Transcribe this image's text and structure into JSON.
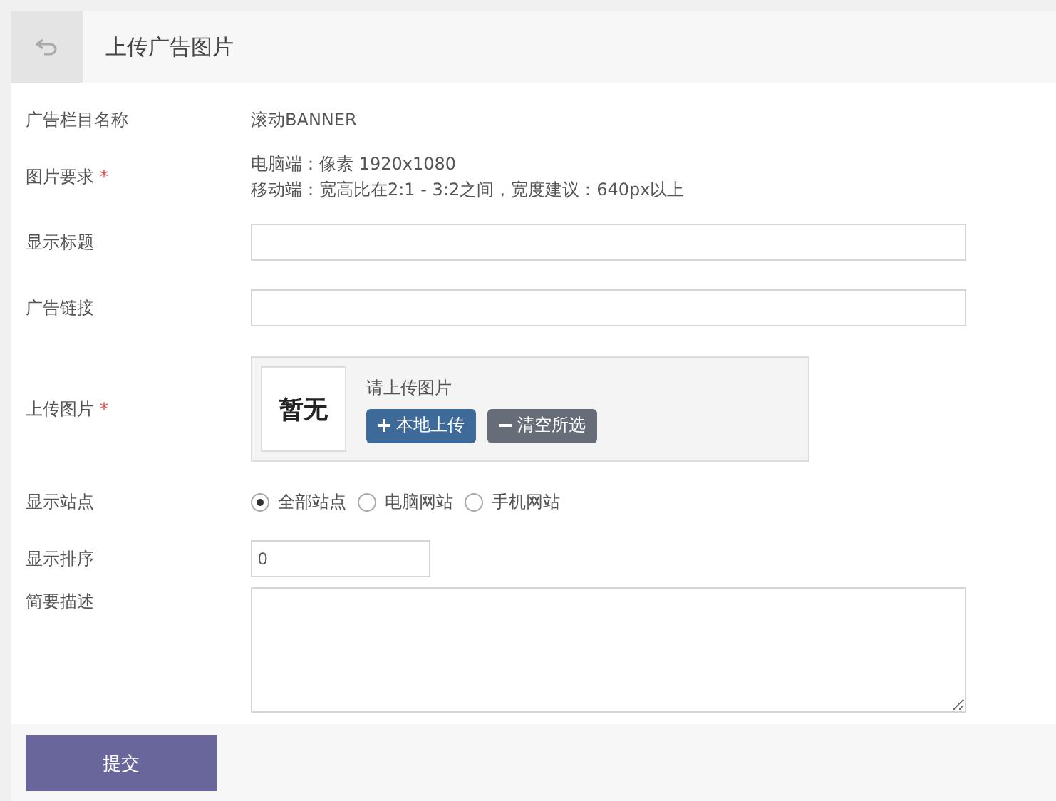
{
  "header": {
    "title": "上传广告图片"
  },
  "fields": [
    {
      "kind": "text",
      "label": "广告栏目名称",
      "lines": [
        "滚动BANNER"
      ]
    },
    {
      "kind": "text",
      "label": "图片要求",
      "required_mark": "*",
      "lines": [
        "电脑端：像素 1920x1080",
        "移动端：宽高比在2:1 - 3:2之间，宽度建议：640px以上"
      ]
    },
    {
      "kind": "input",
      "label": "显示标题"
    },
    {
      "kind": "input",
      "label": "广告链接"
    },
    {
      "kind": "upload",
      "label": "上传图片",
      "required_mark": "*",
      "preview": "暂无",
      "hint": "请上传图片",
      "buttons": [
        {
          "kind": "add",
          "label": "本地上传"
        },
        {
          "kind": "clear",
          "label": "清空所选"
        }
      ]
    },
    {
      "kind": "radio",
      "label": "显示站点",
      "options": [
        {
          "label": "全部站点",
          "selected": true
        },
        {
          "label": "电脑网站",
          "selected": false
        },
        {
          "label": "手机网站",
          "selected": false
        }
      ]
    },
    {
      "kind": "short",
      "label": "显示排序",
      "value": "0"
    },
    {
      "kind": "textarea",
      "label": "简要描述"
    }
  ],
  "submit": "提交"
}
